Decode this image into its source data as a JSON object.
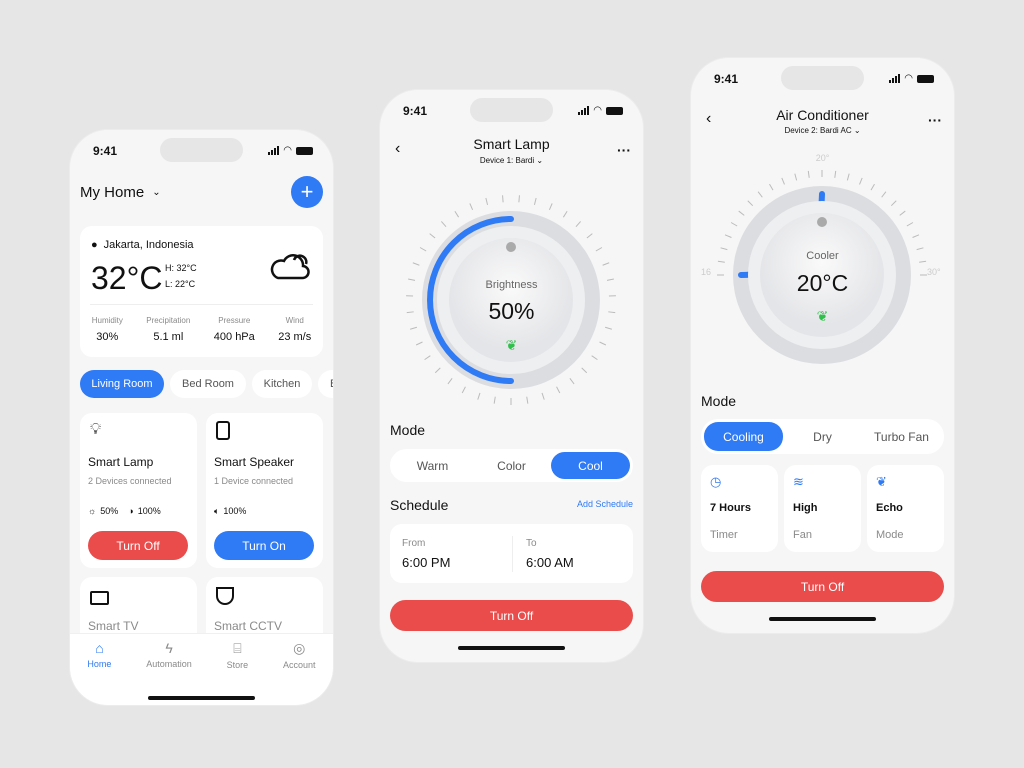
{
  "status": {
    "time": "9:41"
  },
  "home": {
    "title": "My Home",
    "weather": {
      "location": "Jakarta, Indonesia",
      "temp": "32°C",
      "high": "H: 32°C",
      "low": "L: 22°C",
      "stats": [
        {
          "label": "Humidity",
          "value": "30%"
        },
        {
          "label": "Precipitation",
          "value": "5.1 ml"
        },
        {
          "label": "Pressure",
          "value": "400 hPa"
        },
        {
          "label": "Wind",
          "value": "23 m/s"
        }
      ]
    },
    "rooms": [
      "Living Room",
      "Bed Room",
      "Kitchen",
      "B"
    ],
    "devices": [
      {
        "name": "Smart Lamp",
        "sub": "2 Devices connected",
        "stat1": "50%",
        "stat2": "100%",
        "button": "Turn Off"
      },
      {
        "name": "Smart Speaker",
        "sub": "1 Device connected",
        "stat1": "100%",
        "button": "Turn On"
      },
      {
        "name": "Smart TV"
      },
      {
        "name": "Smart CCTV"
      }
    ],
    "nav": [
      "Home",
      "Automation",
      "Store",
      "Account"
    ]
  },
  "lamp": {
    "title": "Smart Lamp",
    "device": "Device 1: Bardi",
    "dial_label": "Brightness",
    "dial_value": "50%",
    "level_percent": 50,
    "mode_title": "Mode",
    "modes": [
      "Warm",
      "Color",
      "Cool"
    ],
    "active_mode": "Cool",
    "schedule_title": "Schedule",
    "add_schedule": "Add Schedule",
    "from_label": "From",
    "from": "6:00 PM",
    "to_label": "To",
    "to": "6:00 AM",
    "button": "Turn Off"
  },
  "ac": {
    "title": "Air Conditioner",
    "device": "Device 2: Bardi AC",
    "scale_min": "16",
    "scale_mid": "20°",
    "scale_max": "30°",
    "dial_label": "Cooler",
    "dial_value": "20°C",
    "temperature": 20,
    "mode_title": "Mode",
    "modes": [
      "Cooling",
      "Dry",
      "Turbo Fan"
    ],
    "active_mode": "Cooling",
    "cards": [
      {
        "value": "7 Hours",
        "label": "Timer"
      },
      {
        "value": "High",
        "label": "Fan"
      },
      {
        "value": "Echo",
        "label": "Mode"
      }
    ],
    "button": "Turn Off"
  },
  "colors": {
    "accent": "#2f7af5",
    "danger": "#ea4c4c",
    "eco": "#2fbf4a"
  }
}
